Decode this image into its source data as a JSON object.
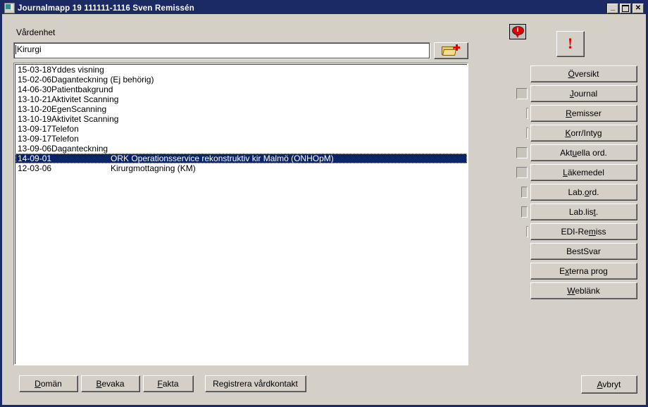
{
  "window": {
    "title": "Journalmapp 19 111111-1116  Sven Remissén",
    "sysicon_name": "window-icon",
    "controls": {
      "minimize": "_",
      "maximize": "❐",
      "close": "✕"
    }
  },
  "form": {
    "vardenhet_label": "Vårdenhet",
    "vardenhet_value": "Kirurgi",
    "vardenhet_placeholder": "",
    "add_folder_icon": "folder-plus-icon"
  },
  "icons": {
    "info_bubble": "info-bubble-icon",
    "info_bubble_glyph": "i",
    "warning_button": "warning-exclamation-icon",
    "warning_glyph": "!"
  },
  "list": {
    "rows": [
      {
        "date": "15-03-18",
        "text": "Yddes visning",
        "two_col": false,
        "selected": false
      },
      {
        "date": "15-02-06",
        "text": "Daganteckning (Ej behörig)",
        "two_col": false,
        "selected": false
      },
      {
        "date": "14-06-30",
        "text": "Patientbakgrund",
        "two_col": false,
        "selected": false
      },
      {
        "date": "13-10-21",
        "text": "Aktivitet Scanning",
        "two_col": false,
        "selected": false
      },
      {
        "date": "13-10-20",
        "text": "EgenScanning",
        "two_col": false,
        "selected": false
      },
      {
        "date": "13-10-19",
        "text": "Aktivitet Scanning",
        "two_col": false,
        "selected": false
      },
      {
        "date": "13-09-17",
        "text": "Telefon",
        "two_col": false,
        "selected": false
      },
      {
        "date": "13-09-17",
        "text": "Telefon",
        "two_col": false,
        "selected": false
      },
      {
        "date": "13-09-06",
        "text": "Daganteckning",
        "two_col": false,
        "selected": false
      },
      {
        "date": "14-09-01",
        "text": "ORK Operationsservice rekonstruktiv kir Malmö (ONHOpM)",
        "two_col": true,
        "selected": true
      },
      {
        "date": "12-03-06",
        "text": "Kirurgmottagning (KM)",
        "two_col": true,
        "selected": false
      }
    ]
  },
  "side_buttons": [
    {
      "label": "Översikt",
      "accel": "Ö",
      "indicator": "none"
    },
    {
      "label": "Journal",
      "accel": "J",
      "indicator": "full"
    },
    {
      "label": "Remisser",
      "accel": "R",
      "indicator": "sliver"
    },
    {
      "label": "Korr/Intyg",
      "accel": "K",
      "indicator": "sliver"
    },
    {
      "label": "Aktuella ord.",
      "accel": "u",
      "indicator": "full"
    },
    {
      "label": "Läkemedel",
      "accel": "L",
      "indicator": "full"
    },
    {
      "label": "Lab.ord.",
      "accel": "o",
      "indicator": "narrow"
    },
    {
      "label": "Lab.list.",
      "accel": "t",
      "indicator": "narrow"
    },
    {
      "label": "EDI-Remiss",
      "accel": "m",
      "indicator": "sliver"
    },
    {
      "label": "BestSvar",
      "accel": "",
      "indicator": "none"
    },
    {
      "label": "Externa prog",
      "accel": "x",
      "indicator": "none"
    },
    {
      "label": "Weblänk",
      "accel": "W",
      "indicator": "none"
    }
  ],
  "bottom_buttons": [
    {
      "label": "Domän",
      "accel": "D"
    },
    {
      "label": "Bevaka",
      "accel": "B"
    },
    {
      "label": "Fakta",
      "accel": "F"
    },
    {
      "label": "Registrera vårdkontakt",
      "accel": "g"
    }
  ],
  "cancel_button": {
    "label": "Avbryt",
    "accel": "A"
  },
  "colors": {
    "titlebar": "#1b2a63",
    "face": "#d4d0c8",
    "selection": "#0a246a",
    "accent_red": "#e00000"
  }
}
